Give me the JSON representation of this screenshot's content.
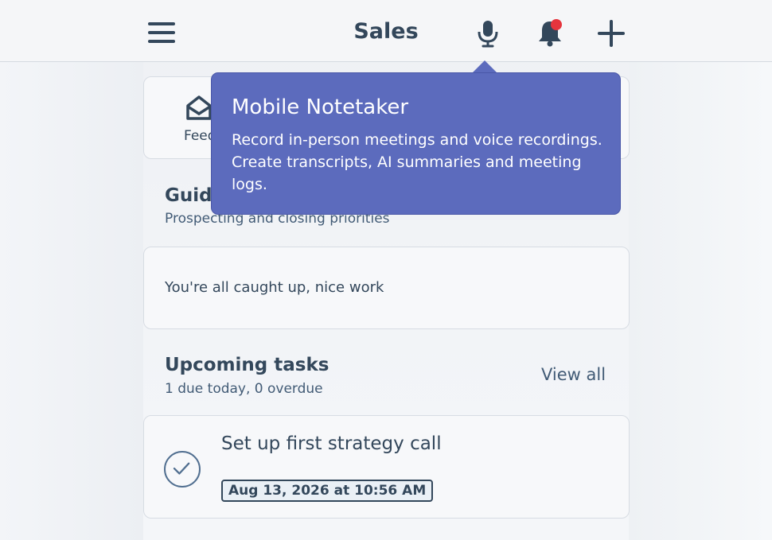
{
  "header": {
    "title": "Sales",
    "icons": {
      "menu": "hamburger-icon",
      "mic": "microphone-icon",
      "notifications": "bell-icon",
      "add": "plus-icon"
    },
    "notification_dot_color": "#e5343d"
  },
  "shortcut": {
    "label": "Feed",
    "icon": "feed-icon"
  },
  "guided": {
    "title": "Guided actions",
    "subtitle": "Prospecting and closing priorities",
    "empty_message": "You're all caught up, nice work"
  },
  "upcoming": {
    "title": "Upcoming tasks",
    "subtitle": "1 due today, 0 overdue",
    "view_all_label": "View all",
    "tasks": [
      {
        "title": "Set up first strategy call",
        "due": "Aug 13, 2026 at 10:56 AM"
      }
    ]
  },
  "tooltip": {
    "title": "Mobile Notetaker",
    "body": "Record in-person meetings and voice recordings. Create transcripts, AI summaries and meeting logs.",
    "background_color": "#5c6bbd"
  }
}
